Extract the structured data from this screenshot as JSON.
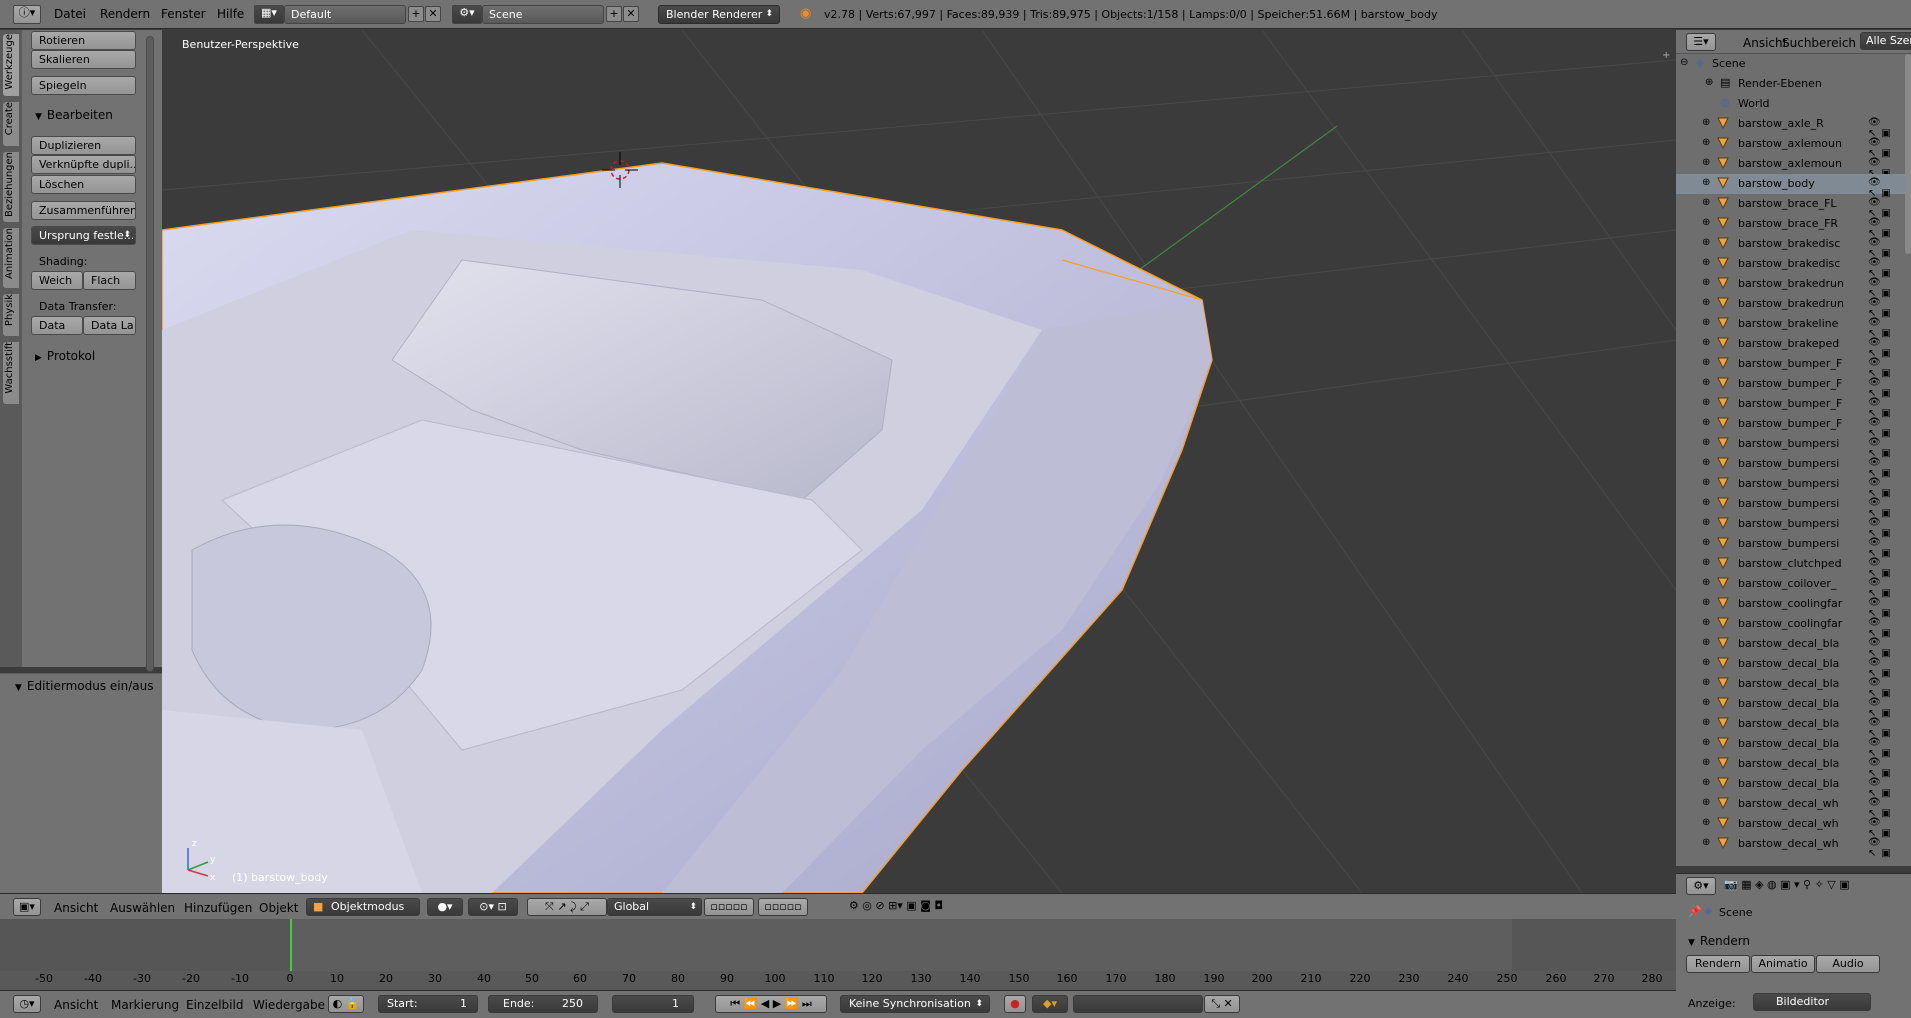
{
  "topbar": {
    "menu": [
      "Datei",
      "Rendern",
      "Fenster",
      "Hilfe"
    ],
    "layout": "Default",
    "scene": "Scene",
    "renderer": "Blender Renderer",
    "info": "v2.78 | Verts:67,997 | Faces:89,939 | Tris:89,975 | Objects:1/158 | Lamps:0/0 | Speicher:51.66M | barstow_body"
  },
  "tool_tabs": [
    "Werkzeuge",
    "Create",
    "Beziehungen",
    "Animation",
    "Physik",
    "Wachsstift"
  ],
  "toolshelf": {
    "rotate": "Rotieren",
    "scale": "Skalieren",
    "mirror": "Spiegeln",
    "edit_header": "Bearbeiten",
    "duplicate": "Duplizieren",
    "linked_dup": "Verknüpfte dupli...",
    "delete": "Löschen",
    "join": "Zusammenführen",
    "origin": "Ursprung festle...",
    "shading_label": "Shading:",
    "smooth": "Weich",
    "flat": "Flach",
    "data_transfer_label": "Data Transfer:",
    "data": "Data",
    "data_la": "Data La",
    "history_header": "Protokol",
    "op_header": "Editiermodus ein/aus"
  },
  "viewport": {
    "perspective": "Benutzer-Perspektive",
    "object_label": "(1) barstow_body",
    "colors": {
      "background": "#3b3b3b",
      "car": "#dcdcf0",
      "selection": "#f5a020",
      "grid": "#4a4a4a"
    }
  },
  "view_header": {
    "menu": [
      "Ansicht",
      "Auswählen",
      "Hinzufügen",
      "Objekt"
    ],
    "mode": "Objektmodus",
    "orientation": "Global"
  },
  "timeline": {
    "ticks": [
      "-50",
      "-40",
      "-30",
      "-20",
      "-10",
      "0",
      "10",
      "20",
      "30",
      "40",
      "50",
      "60",
      "70",
      "80",
      "90",
      "100",
      "110",
      "120",
      "130",
      "140",
      "150",
      "160",
      "170",
      "180",
      "190",
      "200",
      "210",
      "220",
      "230",
      "240",
      "250",
      "260",
      "270",
      "280"
    ],
    "menu": [
      "Ansicht",
      "Markierung",
      "Einzelbild",
      "Wiedergabe"
    ],
    "start_label": "Start:",
    "start_value": "1",
    "end_label": "Ende:",
    "end_value": "250",
    "current": "1",
    "sync": "Keine Synchronisation"
  },
  "outliner": {
    "tabs": [
      "Ansicht",
      "Suchbereich",
      "Alle Szen"
    ],
    "scene": "Scene",
    "render_layers": "Render-Ebenen",
    "world": "World",
    "objects": [
      "barstow_axle_R",
      "barstow_axlemoun",
      "barstow_axlemoun",
      "barstow_body",
      "barstow_brace_FL",
      "barstow_brace_FR",
      "barstow_brakedisc",
      "barstow_brakedisc",
      "barstow_brakedrun",
      "barstow_brakedrun",
      "barstow_brakeline",
      "barstow_brakeped",
      "barstow_bumper_F",
      "barstow_bumper_F",
      "barstow_bumper_F",
      "barstow_bumper_F",
      "barstow_bumpersi",
      "barstow_bumpersi",
      "barstow_bumpersi",
      "barstow_bumpersi",
      "barstow_bumpersi",
      "barstow_bumpersi",
      "barstow_clutchped",
      "barstow_coilover_",
      "barstow_coolingfar",
      "barstow_coolingfar",
      "barstow_decal_bla",
      "barstow_decal_bla",
      "barstow_decal_bla",
      "barstow_decal_bla",
      "barstow_decal_bla",
      "barstow_decal_bla",
      "barstow_decal_bla",
      "barstow_decal_bla",
      "barstow_decal_wh",
      "barstow_decal_wh",
      "barstow_decal_wh"
    ],
    "selected_index": 3
  },
  "properties": {
    "scene": "Scene",
    "render_header": "Rendern",
    "buttons": [
      "Rendern",
      "Animatio",
      "Audio"
    ],
    "display_label": "Anzeige:",
    "display_value": "Bildeditor"
  }
}
